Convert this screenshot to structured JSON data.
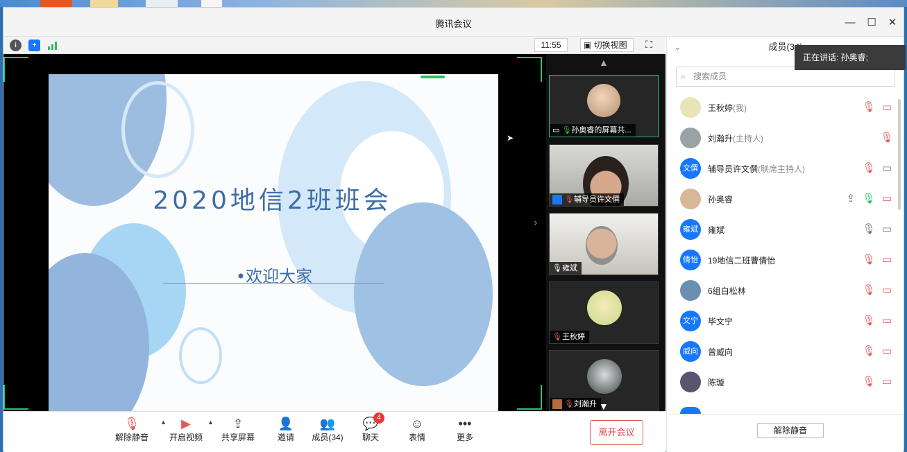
{
  "window": {
    "title": "腾讯会议"
  },
  "infobar": {
    "time": "11:55",
    "switch_view": "切换视图"
  },
  "slide": {
    "title": "2020地信2班班会",
    "subtitle": "•欢迎大家"
  },
  "thumbnails": [
    {
      "name": "孙奥睿的屏幕共..."
    },
    {
      "name": "辅导员许文僎"
    },
    {
      "name": "雍斌"
    },
    {
      "name": "王秋婷"
    },
    {
      "name": "刘瀚升"
    }
  ],
  "toolbar": {
    "unmute": "解除静音",
    "video": "开启视频",
    "share": "共享屏幕",
    "invite": "邀请",
    "members": "成员(34)",
    "chat": "聊天",
    "chat_badge": "4",
    "reactions": "表情",
    "more": "更多",
    "leave": "离开会议"
  },
  "panel": {
    "header": "成员(34)",
    "speaking": "正在讲话: 孙奥睿;",
    "search_placeholder": "搜索成员",
    "unmute_all": "解除静音",
    "members": [
      {
        "name": "王秋婷",
        "role": "(我)",
        "avatar_text": "",
        "avatar_color": "#e9e4b8"
      },
      {
        "name": "刘瀚升",
        "role": "(主持人)",
        "avatar_text": "",
        "avatar_color": "#9aa3a3"
      },
      {
        "name": "辅导员许文僎",
        "role": "(联席主持人)",
        "avatar_text": "文僎",
        "avatar_color": "#1677ff"
      },
      {
        "name": "孙奥睿",
        "role": "",
        "avatar_text": "",
        "avatar_color": "#d9b89a"
      },
      {
        "name": "雍斌",
        "role": "",
        "avatar_text": "雍斌",
        "avatar_color": "#1677ff"
      },
      {
        "name": "19地信二班曹倩怡",
        "role": "",
        "avatar_text": "倩怡",
        "avatar_color": "#1677ff"
      },
      {
        "name": "6组白松林",
        "role": "",
        "avatar_text": "",
        "avatar_color": "#6c8fb0"
      },
      {
        "name": "毕文宁",
        "role": "",
        "avatar_text": "文宁",
        "avatar_color": "#1677ff"
      },
      {
        "name": "曾威向",
        "role": "",
        "avatar_text": "威向",
        "avatar_color": "#1677ff"
      },
      {
        "name": "陈璇",
        "role": "",
        "avatar_text": "",
        "avatar_color": "#5b5470"
      }
    ]
  }
}
